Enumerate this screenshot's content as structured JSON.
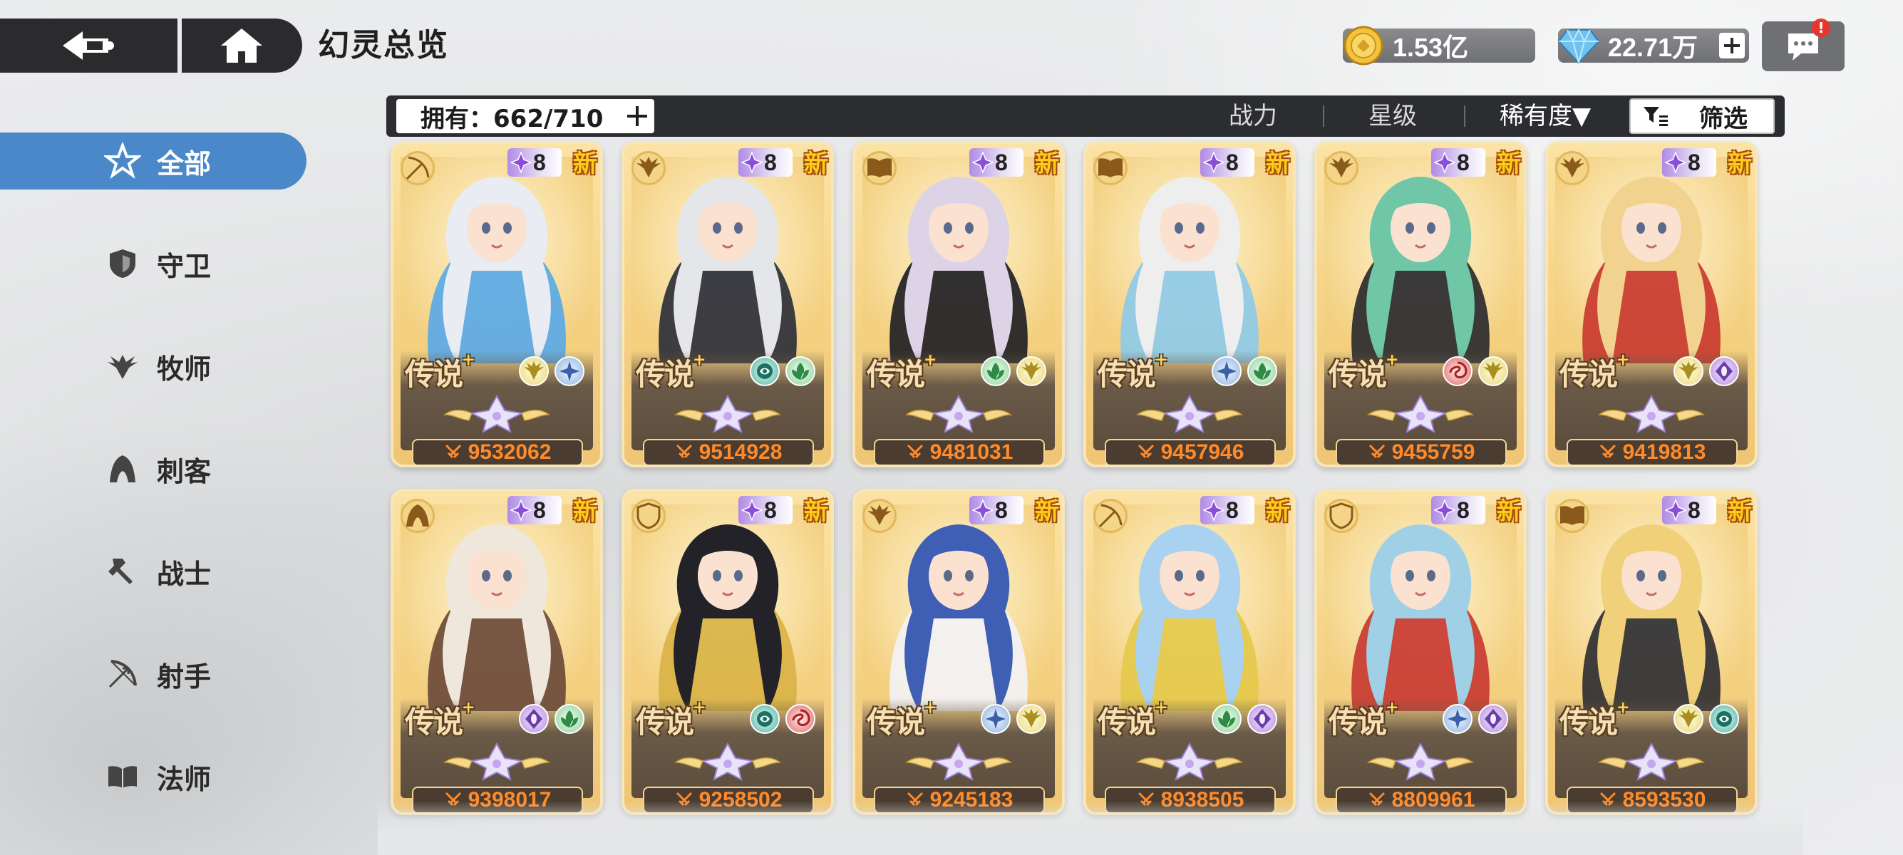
{
  "header": {
    "title": "幻灵总览",
    "back_icon": "back-arrow-icon",
    "home_icon": "home-icon"
  },
  "currency": {
    "gold": {
      "value": "1.53亿",
      "icon": "gold-coin-icon"
    },
    "gem": {
      "value": "22.71万",
      "icon": "diamond-icon"
    }
  },
  "chat": {
    "icon": "chat-bubble-icon",
    "badge": "!"
  },
  "filter_bar": {
    "owned": "拥有：662/710",
    "sort_power": "战力",
    "sort_star": "星级",
    "sort_rarity": "稀有度▼",
    "filter_label": "筛选"
  },
  "sidebar": {
    "items": [
      {
        "label": "全部",
        "icon": "all-star-icon",
        "active": true
      },
      {
        "label": "守卫",
        "icon": "shield-icon",
        "active": false
      },
      {
        "label": "牧师",
        "icon": "priest-wing-icon",
        "active": false
      },
      {
        "label": "刺客",
        "icon": "assassin-hood-icon",
        "active": false
      },
      {
        "label": "战士",
        "icon": "warrior-hammer-icon",
        "active": false
      },
      {
        "label": "射手",
        "icon": "archer-bow-icon",
        "active": false
      },
      {
        "label": "法师",
        "icon": "mage-book-icon",
        "active": false
      }
    ]
  },
  "cards": [
    {
      "class": "archer",
      "stars": "8",
      "new": "新",
      "rarity": "传说",
      "elements": [
        "light",
        "star"
      ],
      "power": "9532062",
      "hair": "#e9ecf2",
      "outfit": "#5aa9e6"
    },
    {
      "class": "priest",
      "stars": "8",
      "new": "新",
      "rarity": "传说",
      "elements": [
        "void",
        "nature"
      ],
      "power": "9514928",
      "hair": "#e4e6ea",
      "outfit": "#2d2f3a"
    },
    {
      "class": "mage",
      "stars": "8",
      "new": "新",
      "rarity": "传说",
      "elements": [
        "nature",
        "light"
      ],
      "power": "9481031",
      "hair": "#ddd3e6",
      "outfit": "#1f1f24"
    },
    {
      "class": "mage",
      "stars": "8",
      "new": "新",
      "rarity": "传说",
      "elements": [
        "star",
        "nature"
      ],
      "power": "9457946",
      "hair": "#eeeeef",
      "outfit": "#8ecae8"
    },
    {
      "class": "priest",
      "stars": "8",
      "new": "新",
      "rarity": "传说",
      "elements": [
        "chaos",
        "light"
      ],
      "power": "9455759",
      "hair": "#6fc7a8",
      "outfit": "#2a2a2f"
    },
    {
      "class": "priest",
      "stars": "8",
      "new": "新",
      "rarity": "传说",
      "elements": [
        "light",
        "dark"
      ],
      "power": "9419813",
      "hair": "#f1d38f",
      "outfit": "#c9392f"
    },
    {
      "class": "assassin",
      "stars": "8",
      "new": "新",
      "rarity": "传说",
      "elements": [
        "dark",
        "nature"
      ],
      "power": "9398017",
      "hair": "#efe7dc",
      "outfit": "#6b4a3a"
    },
    {
      "class": "guard",
      "stars": "8",
      "new": "新",
      "rarity": "传说",
      "elements": [
        "void",
        "chaos"
      ],
      "power": "9258502",
      "hair": "#222228",
      "outfit": "#d9b347"
    },
    {
      "class": "priest",
      "stars": "8",
      "new": "新",
      "rarity": "传说",
      "elements": [
        "star",
        "light"
      ],
      "power": "9245183",
      "hair": "#3f5fb5",
      "outfit": "#f2f2f5"
    },
    {
      "class": "archer",
      "stars": "8",
      "new": "新",
      "rarity": "传说",
      "elements": [
        "nature",
        "dark"
      ],
      "power": "8938505",
      "hair": "#a8d2f0",
      "outfit": "#e4c94c"
    },
    {
      "class": "guard",
      "stars": "8",
      "new": "新",
      "rarity": "传说",
      "elements": [
        "star",
        "dark"
      ],
      "power": "8809961",
      "hair": "#9fd0e6",
      "outfit": "#c83a32"
    },
    {
      "class": "mage",
      "stars": "8",
      "new": "新",
      "rarity": "传说",
      "elements": [
        "light",
        "void"
      ],
      "power": "8593530",
      "hair": "#f0d078",
      "outfit": "#2f2f33"
    }
  ],
  "colors": {
    "sidebar_active": "#4a88c9",
    "topbar_dark": "#2b2b2d",
    "power_text": "#ff8a2a",
    "new_tag": "#ffcc1a"
  }
}
